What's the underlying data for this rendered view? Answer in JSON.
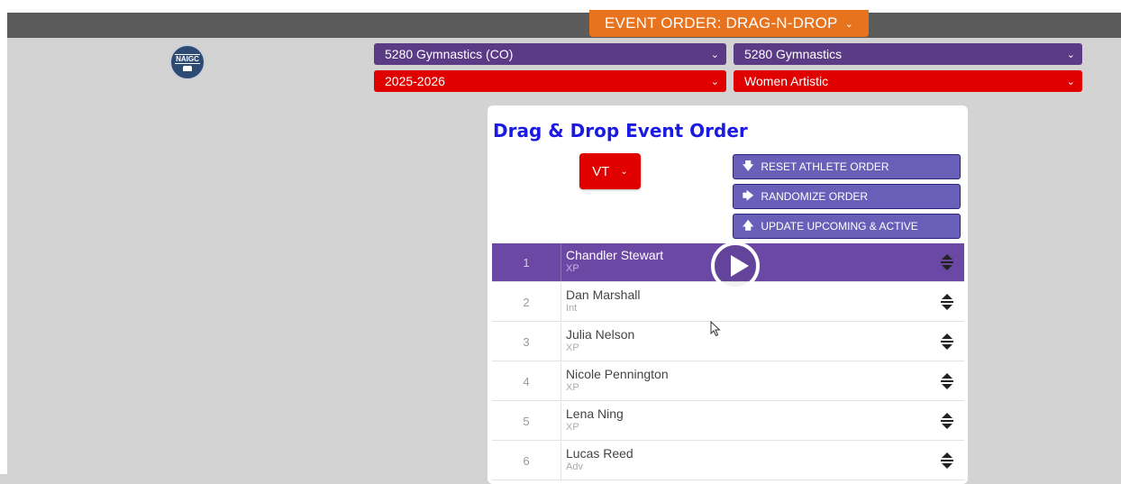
{
  "header": {
    "event_menu_label": "EVENT ORDER: DRAG-N-DROP",
    "logo_text": "NAIGC"
  },
  "filters": {
    "gym_group": "5280 Gymnastics (CO)",
    "gym": "5280 Gymnastics",
    "season": "2025-2026",
    "discipline": "Women Artistic"
  },
  "panel": {
    "title": "Drag & Drop Event Order",
    "event_select": "VT",
    "buttons": {
      "reset": "RESET ATHLETE ORDER",
      "randomize": "RANDOMIZE ORDER",
      "update": "UPDATE UPCOMING & ACTIVE"
    }
  },
  "athletes": [
    {
      "order": "1",
      "name": "Chandler Stewart",
      "level": "XP"
    },
    {
      "order": "2",
      "name": "Dan Marshall",
      "level": "Int"
    },
    {
      "order": "3",
      "name": "Julia Nelson",
      "level": "XP"
    },
    {
      "order": "4",
      "name": "Nicole Pennington",
      "level": "XP"
    },
    {
      "order": "5",
      "name": "Lena Ning",
      "level": "XP"
    },
    {
      "order": "6",
      "name": "Lucas Reed",
      "level": "Adv"
    }
  ],
  "colors": {
    "accent_orange": "#e8731f",
    "purple": "#5b3b86",
    "red": "#e00000",
    "active_row": "#6a48a3",
    "button": "#6a5fb8",
    "title_blue": "#1a1ae0"
  }
}
